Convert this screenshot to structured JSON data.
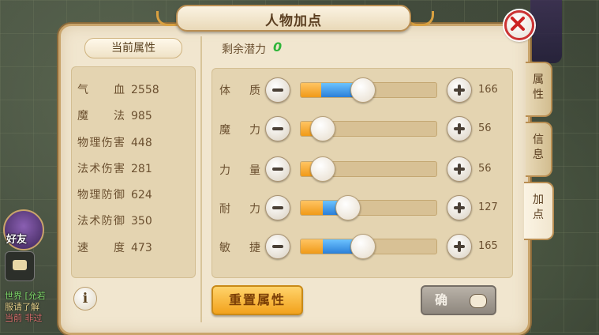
{
  "window": {
    "title": "人物加点"
  },
  "attributes": {
    "header": "当前属性",
    "rows": [
      {
        "label": "气 血",
        "value": "2558"
      },
      {
        "label": "魔 法",
        "value": "985"
      },
      {
        "label": "物理伤害",
        "value": "448"
      },
      {
        "label": "法术伤害",
        "value": "281"
      },
      {
        "label": "物理防御",
        "value": "624"
      },
      {
        "label": "法术防御",
        "value": "350"
      },
      {
        "label": "速 度",
        "value": "473"
      }
    ]
  },
  "potential": {
    "label": "剩余潜力",
    "value": "0"
  },
  "stats": [
    {
      "label": "体 质",
      "value": "166",
      "level": 0.46,
      "base": 0.15
    },
    {
      "label": "魔 力",
      "value": "56",
      "level": 0.16,
      "base": 0.16
    },
    {
      "label": "力 量",
      "value": "56",
      "level": 0.16,
      "base": 0.16
    },
    {
      "label": "耐 力",
      "value": "127",
      "level": 0.35,
      "base": 0.16
    },
    {
      "label": "敏 捷",
      "value": "165",
      "level": 0.46,
      "base": 0.16
    }
  ],
  "buttons": {
    "reset": "重置属性",
    "confirm": "确"
  },
  "tabs": [
    {
      "label": "属性",
      "active": false
    },
    {
      "label": "信息",
      "active": false
    },
    {
      "label": "加点",
      "active": true
    }
  ],
  "hud": {
    "friend": "好友",
    "chat": [
      {
        "text": "世界 [允若"
      },
      {
        "text": "服请了解"
      },
      {
        "text": "当前 非过"
      }
    ]
  },
  "colors": {
    "accent": "#c9a46b",
    "potential": "#2fb53a",
    "close": "#cc3333"
  }
}
